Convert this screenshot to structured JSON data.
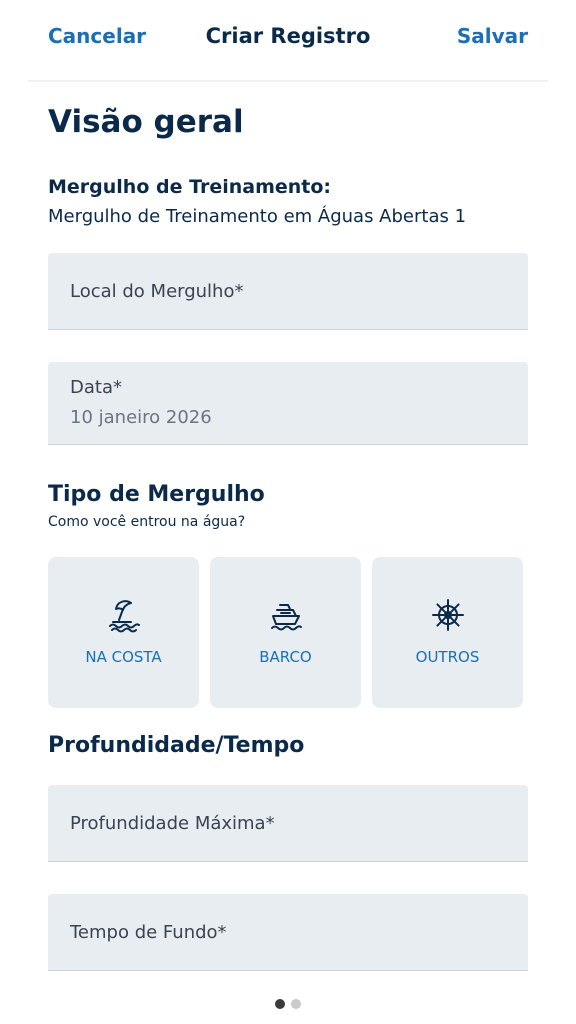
{
  "header": {
    "cancel_label": "Cancelar",
    "title": "Criar Registro",
    "save_label": "Salvar"
  },
  "overview": {
    "heading": "Visão geral",
    "training_label": "Mergulho de Treinamento:",
    "training_value": "Mergulho de Treinamento em Águas Abertas 1"
  },
  "fields": {
    "dive_site": {
      "label": "Local do Mergulho*"
    },
    "date": {
      "label": "Data*",
      "value": "10 janeiro 2026"
    },
    "max_depth": {
      "label": "Profundidade Máxima*"
    },
    "bottom_time": {
      "label": "Tempo de Fundo*"
    }
  },
  "dive_type": {
    "heading": "Tipo de Mergulho",
    "subheading": "Como você entrou na água?",
    "options": [
      {
        "label": "NA COSTA",
        "icon": "beach-umbrella-icon"
      },
      {
        "label": "BARCO",
        "icon": "boat-icon"
      },
      {
        "label": "OUTROS",
        "icon": "ship-wheel-icon"
      }
    ]
  },
  "depth_time": {
    "heading": "Profundidade/Tempo"
  },
  "pager": {
    "total": 2,
    "active": 1
  },
  "colors": {
    "accent": "#1a6fb5",
    "text_dark": "#0b2a4a",
    "field_bg": "#e8edf2"
  }
}
